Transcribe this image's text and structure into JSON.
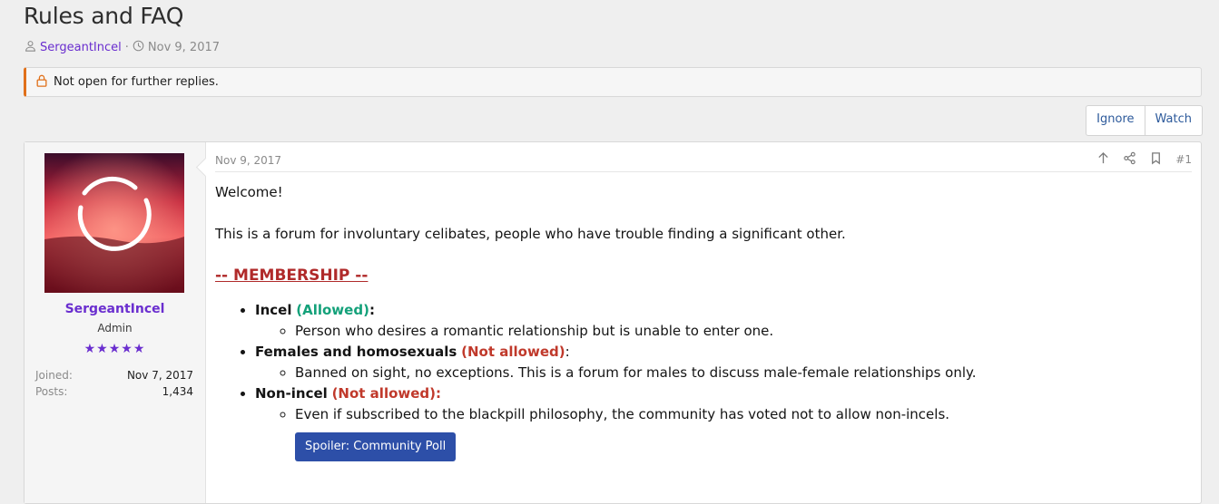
{
  "thread": {
    "title": "Rules and FAQ",
    "author": "SergeantIncel",
    "separator": "·",
    "date": "Nov 9, 2017"
  },
  "notice": {
    "text": "Not open for further replies."
  },
  "actions": {
    "ignore": "Ignore",
    "watch": "Watch"
  },
  "post": {
    "date": "Nov 9, 2017",
    "number": "#1",
    "user": {
      "name": "SergeantIncel",
      "title": "Admin",
      "stars": "★★★★★",
      "joined_label": "Joined:",
      "joined_value": "Nov 7, 2017",
      "posts_label": "Posts:",
      "posts_value": "1,434"
    },
    "welcome": "Welcome!",
    "intro": "This is a forum for involuntary celibates, people who have trouble finding a significant other.",
    "membership_heading": "-- MEMBERSHIP --",
    "items": [
      {
        "label": "Incel",
        "status": "(Allowed)",
        "suffix": ":",
        "desc": "Person who desires a romantic relationship but is unable to enter one."
      },
      {
        "label": "Females and homosexuals",
        "status": "(Not allowed)",
        "suffix": ":",
        "desc": "Banned on sight, no exceptions. This is a forum for males to discuss male-female relationships only."
      },
      {
        "label": "Non-incel",
        "status": "(Not allowed):",
        "suffix": "",
        "desc": "Even if subscribed to the blackpill philosophy, the community has voted not to allow non-incels."
      }
    ],
    "spoiler": "Spoiler: Community Poll"
  },
  "colors": {
    "accent_purple": "#6a2ecf",
    "notice_orange": "#e0701a",
    "allowed_green": "#14a17a",
    "not_allowed_red": "#c0392b",
    "spoiler_blue": "#2d4fa8"
  }
}
